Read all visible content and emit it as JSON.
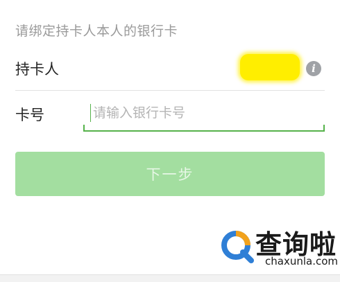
{
  "header": {
    "hint": "请绑定持卡人本人的银行卡"
  },
  "form": {
    "holder": {
      "label": "持卡人",
      "info_icon": "info-icon"
    },
    "card": {
      "label": "卡号",
      "placeholder": "请输入银行卡号",
      "value": ""
    },
    "next_label": "下一步"
  },
  "watermark": {
    "brand": "查询啦",
    "url": "chaxunla.com"
  },
  "colors": {
    "accent": "#55b24a",
    "button": "#a3dea0",
    "mask": "#ffee00",
    "logo_blue": "#2f7fd6",
    "logo_orange": "#f2a21c"
  }
}
